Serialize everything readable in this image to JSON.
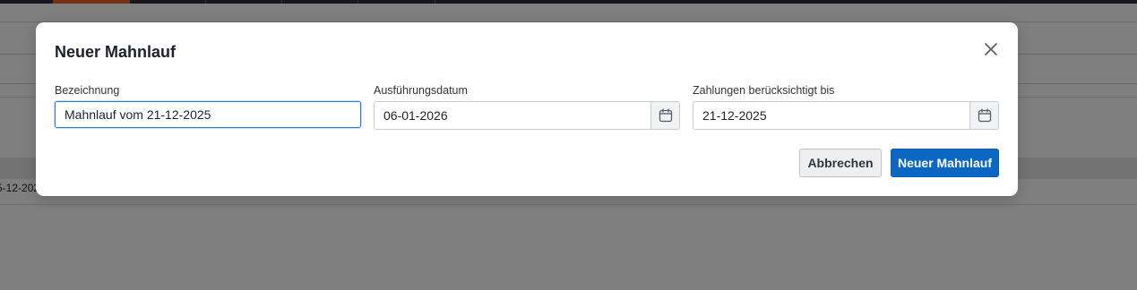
{
  "background": {
    "row_date_fragment": "5-12-202",
    "row_text_fragment": "@"
  },
  "dialog": {
    "title": "Neuer Mahnlauf",
    "close_icon": "close-icon",
    "fields": {
      "bezeichnung": {
        "label": "Bezeichnung",
        "value": "Mahnlauf vom 21-12-2025"
      },
      "ausfuehrungsdatum": {
        "label": "Ausführungsdatum",
        "value": "06-01-2026",
        "icon": "calendar-icon"
      },
      "zahlungen_bis": {
        "label": "Zahlungen berücksichtigt bis",
        "value": "21-12-2025",
        "icon": "calendar-icon"
      }
    },
    "buttons": {
      "cancel_label": "Abbrechen",
      "submit_label": "Neuer Mahnlauf"
    }
  },
  "colors": {
    "primary": "#0b67c2",
    "active_tab": "#e8622a",
    "focus": "#2a7fd4"
  }
}
